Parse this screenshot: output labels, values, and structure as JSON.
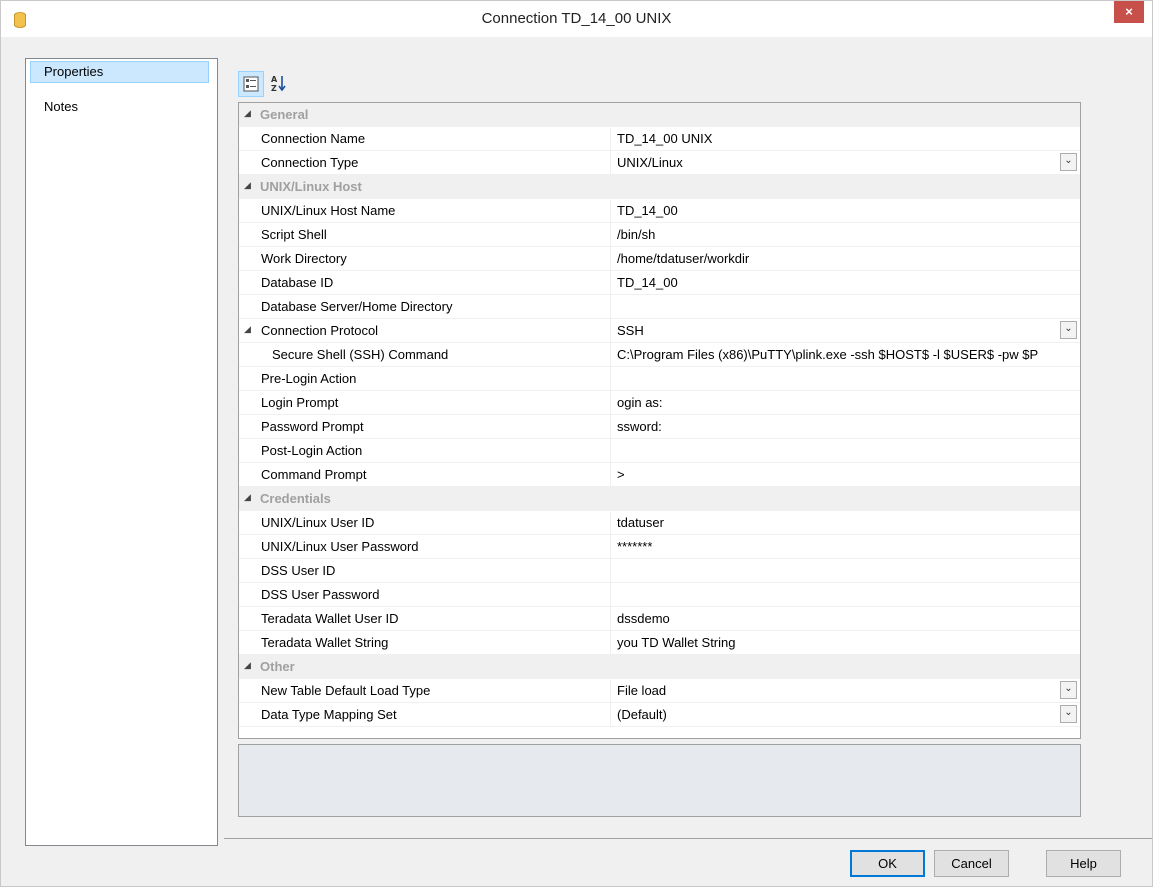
{
  "window": {
    "title": "Connection TD_14_00 UNIX",
    "close_label": "×"
  },
  "nav": {
    "items": [
      {
        "label": "Properties",
        "selected": true
      },
      {
        "label": "Notes",
        "selected": false
      }
    ]
  },
  "toolbar": {
    "categorized_icon": "categorized-view-icon",
    "alphabetical_icon": "alphabetical-sort-icon"
  },
  "categories": [
    {
      "name": "General",
      "rows": [
        {
          "label": "Connection Name",
          "value": "TD_14_00 UNIX"
        },
        {
          "label": "Connection Type",
          "value": "UNIX/Linux",
          "dropdown": true
        }
      ]
    },
    {
      "name": "UNIX/Linux Host",
      "rows": [
        {
          "label": "UNIX/Linux Host Name",
          "value": "TD_14_00"
        },
        {
          "label": "Script Shell",
          "value": "/bin/sh"
        },
        {
          "label": "Work Directory",
          "value": "/home/tdatuser/workdir"
        },
        {
          "label": "Database ID",
          "value": "TD_14_00"
        },
        {
          "label": "Database Server/Home Directory",
          "value": ""
        },
        {
          "label": "Connection Protocol",
          "value": "SSH",
          "dropdown": true,
          "expandable": true
        },
        {
          "label": "Secure Shell (SSH) Command",
          "value": "C:\\Program Files (x86)\\PuTTY\\plink.exe -ssh $HOST$ -l $USER$ -pw $P",
          "indent": true
        },
        {
          "label": "Pre-Login Action",
          "value": ""
        },
        {
          "label": "Login Prompt",
          "value": "ogin as:"
        },
        {
          "label": "Password Prompt",
          "value": "ssword:"
        },
        {
          "label": "Post-Login Action",
          "value": ""
        },
        {
          "label": "Command Prompt",
          "value": ">"
        }
      ]
    },
    {
      "name": "Credentials",
      "rows": [
        {
          "label": "UNIX/Linux User ID",
          "value": "tdatuser"
        },
        {
          "label": "UNIX/Linux User Password",
          "value": "*******"
        },
        {
          "label": "DSS User ID",
          "value": ""
        },
        {
          "label": "DSS User Password",
          "value": ""
        },
        {
          "label": "Teradata Wallet User ID",
          "value": "dssdemo"
        },
        {
          "label": "Teradata Wallet String",
          "value": "you TD Wallet String"
        }
      ]
    },
    {
      "name": "Other",
      "rows": [
        {
          "label": "New Table Default Load Type",
          "value": "File load",
          "dropdown": true
        },
        {
          "label": "Data Type Mapping Set",
          "value": "(Default)",
          "dropdown": true
        }
      ]
    }
  ],
  "buttons": {
    "ok": "OK",
    "cancel": "Cancel",
    "help": "Help"
  }
}
